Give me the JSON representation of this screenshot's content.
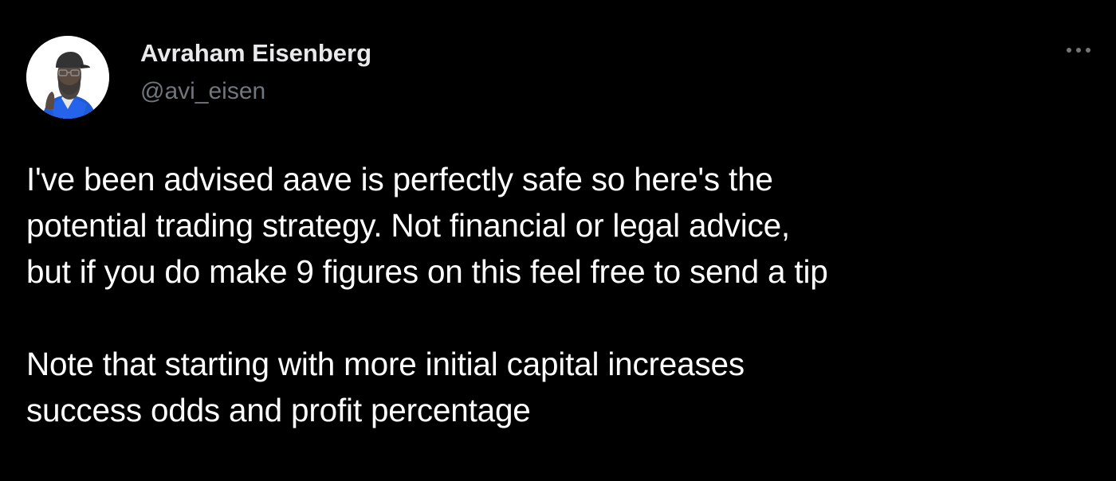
{
  "author": {
    "display_name": "Avraham Eisenberg",
    "handle": "@avi_eisen",
    "avatar_icon": "profile-avatar-illustration"
  },
  "actions": {
    "more_icon": "more-horizontal-icon"
  },
  "tweet": {
    "paragraph_1": [
      "I've been advised aave is perfectly safe so here's the",
      "potential trading strategy. Not financial or legal advice,",
      "but if you do make 9 figures on this feel free to send a tip"
    ],
    "paragraph_2": [
      "Note that starting with more initial capital increases",
      "success odds and profit percentage"
    ]
  },
  "colors": {
    "background": "#000000",
    "text_primary": "#ffffff",
    "text_secondary": "#71767b"
  }
}
